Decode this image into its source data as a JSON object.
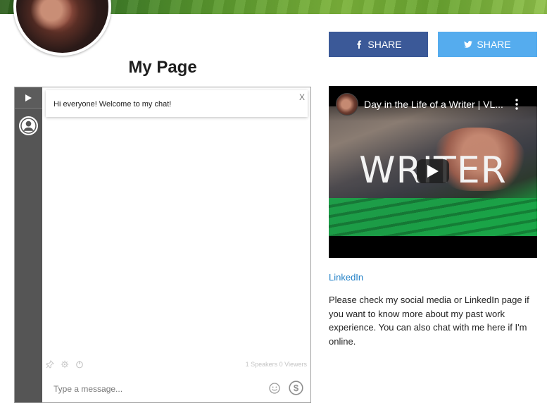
{
  "profile": {
    "title": "My Page"
  },
  "share": {
    "facebook_label": "SHARE",
    "twitter_label": "SHARE"
  },
  "chat": {
    "welcome_message": "Hi everyone! Welcome to my chat!",
    "close_label": "X",
    "stats": "1 Speakers  0 Viewers",
    "input_placeholder": "Type a message..."
  },
  "video": {
    "title": "Day in the Life of a Writer | VL...",
    "thumbnail_word": "WRITER"
  },
  "links": {
    "linkedin_label": "LinkedIn"
  },
  "about": {
    "text": "Please check my social media or LinkedIn page if you want to know more about my past work experience. You can also chat with me here if I'm online."
  },
  "icons": {
    "facebook": "facebook-icon",
    "twitter": "twitter-icon",
    "play": "play-icon",
    "user": "user-icon",
    "pin": "pin-icon",
    "settings": "gear-icon",
    "power": "power-icon",
    "emoji": "emoji-icon",
    "tip": "dollar-icon",
    "more": "more-vertical-icon"
  },
  "colors": {
    "facebook": "#3b5998",
    "twitter": "#55acee",
    "link": "#1f7fc6",
    "chat_rail": "#555555"
  }
}
